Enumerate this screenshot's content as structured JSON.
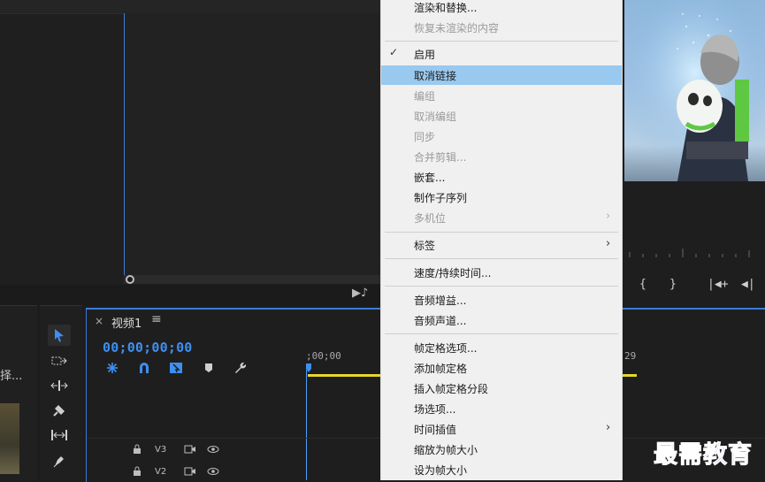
{
  "context_menu": {
    "items": [
      {
        "label": "渲染和替换...",
        "disabled": false
      },
      {
        "label": "恢复未渲染的内容",
        "disabled": true
      },
      {
        "label": "启用",
        "disabled": false,
        "checked": true
      },
      {
        "label": "取消链接",
        "disabled": false,
        "highlighted": true
      },
      {
        "label": "编组",
        "disabled": true
      },
      {
        "label": "取消编组",
        "disabled": true
      },
      {
        "label": "同步",
        "disabled": true
      },
      {
        "label": "合并剪辑...",
        "disabled": true
      },
      {
        "label": "嵌套...",
        "disabled": false
      },
      {
        "label": "制作子序列",
        "disabled": false
      },
      {
        "label": "多机位",
        "disabled": true,
        "submenu": true
      },
      {
        "label": "标签",
        "disabled": false,
        "submenu": true
      },
      {
        "label": "速度/持续时间...",
        "disabled": false
      },
      {
        "label": "音频增益...",
        "disabled": false
      },
      {
        "label": "音频声道...",
        "disabled": false
      },
      {
        "label": "帧定格选项...",
        "disabled": false
      },
      {
        "label": "添加帧定格",
        "disabled": false
      },
      {
        "label": "插入帧定格分段",
        "disabled": false
      },
      {
        "label": "场选项...",
        "disabled": false
      },
      {
        "label": "时间插值",
        "disabled": false,
        "submenu": true
      },
      {
        "label": "缩放为帧大小",
        "disabled": false
      },
      {
        "label": "设为帧大小",
        "disabled": false
      }
    ],
    "check_glyph": "✓",
    "submenu_glyph": "›"
  },
  "timeline": {
    "close_glyph": "×",
    "tab_title": "视频1",
    "menu_glyph": "≡",
    "timecode": "00;00;00;00",
    "ruler_start": ";00;00",
    "ruler_end": "29",
    "tracks": [
      {
        "name": "V3"
      },
      {
        "name": "V2"
      }
    ]
  },
  "project_panel": {
    "label_fragment": "择..."
  },
  "program_monitor": {
    "controls": [
      "{",
      "}",
      "|◀+",
      "◀|"
    ]
  },
  "source_monitor": {
    "export_audio_glyph": "▶♪"
  },
  "watermark": {
    "text": "最需教育"
  },
  "colors": {
    "accent_blue": "#3e8ff0",
    "highlight": "#99c9ef",
    "timeline_yellow": "#e6d72b",
    "watermark": "#1f3fd6"
  }
}
